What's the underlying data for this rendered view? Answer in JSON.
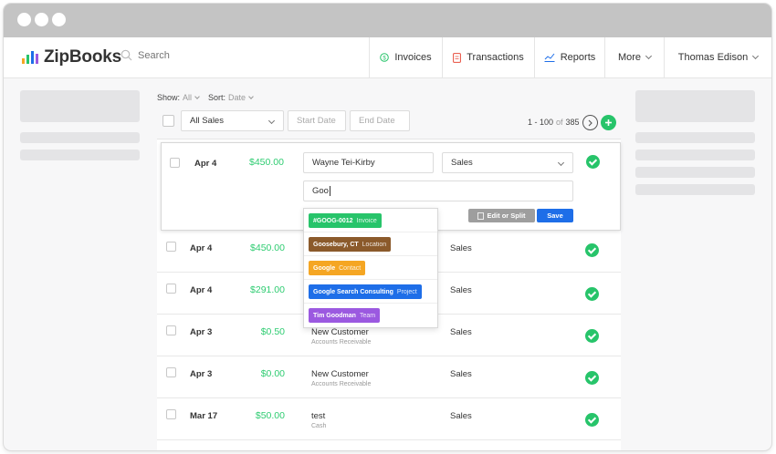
{
  "app": {
    "logo_text": "ZipBooks"
  },
  "colors": {
    "green": "#2ecc71",
    "blue": "#1e6ee8",
    "gray_button": "#9e9e9e"
  },
  "search": {
    "placeholder": "Search",
    "icon": "search-icon"
  },
  "nav": {
    "invoices": "Invoices",
    "transactions": "Transactions",
    "reports": "Reports",
    "more": "More",
    "user": "Thomas Edison"
  },
  "filters": {
    "show_label": "Show:",
    "show_value": "All",
    "sort_label": "Sort:",
    "sort_value": "Date",
    "account_select": "All Sales",
    "start_date_placeholder": "Start Date",
    "end_date_placeholder": "End Date"
  },
  "pager": {
    "range": "1 - 100",
    "of": "of",
    "total": "385"
  },
  "edit_row": {
    "date": "Apr 4",
    "amount": "$450.00",
    "name_value": "Wayne Tei-Kirby",
    "category_value": "Sales",
    "memo_value": "Goo",
    "edit_split_label": "Edit or Split",
    "save_label": "Save"
  },
  "suggestions": [
    {
      "label": "#GOOG-0012",
      "type": "Invoice",
      "color": "#27c46a"
    },
    {
      "label": "Goosebury, CT",
      "type": "Location",
      "color": "#8b5a2b"
    },
    {
      "label": "Google",
      "type": "Contact",
      "color": "#f5a623"
    },
    {
      "label": "Google Search Consulting",
      "type": "Project",
      "color": "#1e6ee8"
    },
    {
      "label": "Tim Goodman",
      "type": "Team",
      "color": "#9b59e0"
    }
  ],
  "rows": [
    {
      "date": "Apr 4",
      "amount": "$450.00",
      "name": "",
      "sub": "",
      "category": "Sales"
    },
    {
      "date": "Apr 4",
      "amount": "$291.00",
      "name": "",
      "sub": "",
      "category": "Sales"
    },
    {
      "date": "Apr 3",
      "amount": "$0.50",
      "name": "New Customer",
      "sub": "Accounts Receivable",
      "category": "Sales"
    },
    {
      "date": "Apr 3",
      "amount": "$0.00",
      "name": "New Customer",
      "sub": "Accounts Receivable",
      "category": "Sales"
    },
    {
      "date": "Mar 17",
      "amount": "$50.00",
      "name": "test",
      "sub": "Cash",
      "category": "Sales"
    }
  ]
}
